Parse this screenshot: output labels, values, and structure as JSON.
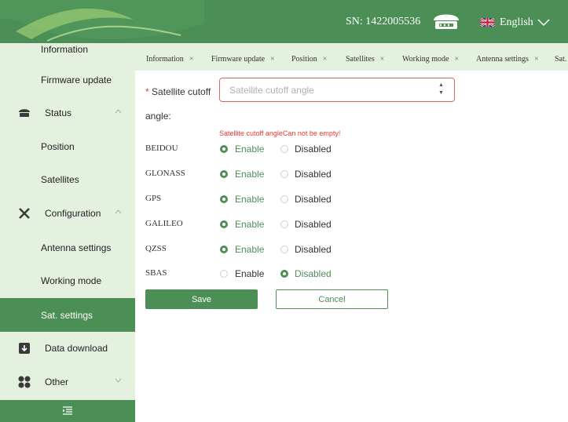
{
  "header": {
    "sn_text": "SN: 1422005536",
    "language": "English",
    "colors": {
      "primary": "#4c8f56",
      "light": "#e4f1df",
      "error": "#e53935"
    }
  },
  "sidebar": {
    "items": [
      {
        "label": "Information",
        "icon": null
      },
      {
        "label": "Firmware update",
        "icon": null
      },
      {
        "label": "Status",
        "icon": "receiver-icon",
        "expandable": true
      },
      {
        "label": "Position",
        "icon": null
      },
      {
        "label": "Satellites",
        "icon": null
      },
      {
        "label": "Configuration",
        "icon": "tools-icon",
        "expandable": true
      },
      {
        "label": "Antenna settings",
        "icon": null
      },
      {
        "label": "Working mode",
        "icon": null
      },
      {
        "label": "Sat. settings",
        "icon": null,
        "active": true
      },
      {
        "label": "Data download",
        "icon": "download-icon"
      },
      {
        "label": "Other",
        "icon": "grid-icon",
        "expandable": true
      }
    ]
  },
  "tabs": [
    {
      "label": "Information"
    },
    {
      "label": "Firmware update"
    },
    {
      "label": "Position"
    },
    {
      "label": "Satellites"
    },
    {
      "label": "Working mode"
    },
    {
      "label": "Antenna settings"
    },
    {
      "label": "Sat."
    }
  ],
  "form": {
    "cutoff_label_line1": "Satellite cutoff",
    "cutoff_label_line2": "angle:",
    "cutoff_placeholder": "Satellite cutoff angle",
    "cutoff_value": "",
    "cutoff_error": "Satellite cutoff angleCan not be empty!",
    "enable_label": "Enable",
    "disabled_label": "Disabled",
    "systems": [
      {
        "name": "BEIDOU",
        "selected": "Enable"
      },
      {
        "name": "GLONASS",
        "selected": "Enable"
      },
      {
        "name": "GPS",
        "selected": "Enable"
      },
      {
        "name": "GALILEO",
        "selected": "Enable"
      },
      {
        "name": "QZSS",
        "selected": "Enable"
      },
      {
        "name": "SBAS",
        "selected": "Disabled"
      }
    ],
    "save_label": "Save",
    "cancel_label": "Cancel"
  }
}
